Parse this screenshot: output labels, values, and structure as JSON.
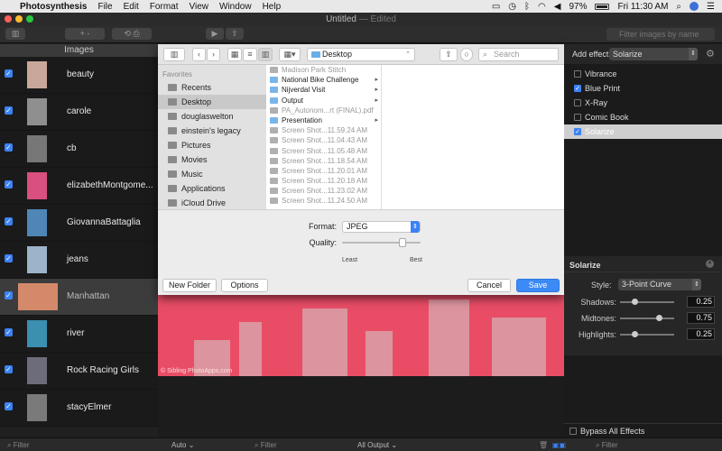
{
  "menubar": {
    "app_name": "Photosynthesis",
    "items": [
      "File",
      "Edit",
      "Format",
      "View",
      "Window",
      "Help"
    ],
    "battery": "97%",
    "clock": "Fri 11:30 AM"
  },
  "window": {
    "title": "Untitled",
    "title_suffix": "— Edited"
  },
  "toolbar": {
    "filter_placeholder": "Filter images by name"
  },
  "sidebar": {
    "header": "Images",
    "images": [
      {
        "name": "beauty",
        "checked": true,
        "thumb_color": "#c9a89a"
      },
      {
        "name": "carole",
        "checked": true,
        "thumb_color": "#8f8f8f"
      },
      {
        "name": "cb",
        "checked": true,
        "thumb_color": "#777777"
      },
      {
        "name": "elizabethMontgome...",
        "checked": true,
        "thumb_color": "#d94f7f"
      },
      {
        "name": "GiovannaBattaglia",
        "checked": true,
        "thumb_color": "#4f86b8"
      },
      {
        "name": "jeans",
        "checked": true,
        "thumb_color": "#9cb3c9"
      },
      {
        "name": "Manhattan",
        "checked": true,
        "thumb_color": "#d48a6a"
      },
      {
        "name": "river",
        "checked": true,
        "thumb_color": "#3b8fb0"
      },
      {
        "name": "Rock Racing Girls",
        "checked": true,
        "thumb_color": "#6c6c7a"
      },
      {
        "name": "stacyElmer",
        "checked": true,
        "thumb_color": "#7a7a7a"
      }
    ]
  },
  "save_sheet": {
    "location": "Desktop",
    "search_placeholder": "Search",
    "favorites_title": "Favorites",
    "favorites": [
      "Recents",
      "Desktop",
      "douglaswelton",
      "einstein's legacy",
      "Pictures",
      "Movies",
      "Music",
      "Applications",
      "iCloud Drive"
    ],
    "selected_favorite": "Desktop",
    "files": [
      {
        "name": "Madison Park Stitch",
        "folder": false
      },
      {
        "name": "National Bike Challenge",
        "folder": true
      },
      {
        "name": "Nijverdal Visit",
        "folder": true
      },
      {
        "name": "Output",
        "folder": true
      },
      {
        "name": "PA_Autonom...rt (FINAL).pdf",
        "folder": false
      },
      {
        "name": "Presentation",
        "folder": true
      },
      {
        "name": "Screen Shot...11.59.24 AM",
        "folder": false
      },
      {
        "name": "Screen Shot...11.04.43 AM",
        "folder": false
      },
      {
        "name": "Screen Shot...11.05.48 AM",
        "folder": false
      },
      {
        "name": "Screen Shot...11.18.54 AM",
        "folder": false
      },
      {
        "name": "Screen Shot...11.20.01 AM",
        "folder": false
      },
      {
        "name": "Screen Shot...11.20.18 AM",
        "folder": false
      },
      {
        "name": "Screen Shot...11.23.02 AM",
        "folder": false
      },
      {
        "name": "Screen Shot...11.24.50 AM",
        "folder": false
      }
    ],
    "format_label": "Format:",
    "format_value": "JPEG",
    "quality_label": "Quality:",
    "quality_fraction": 0.8,
    "quality_min_label": "Least",
    "quality_max_label": "Best",
    "new_folder": "New Folder",
    "options": "Options",
    "cancel": "Cancel",
    "save": "Save"
  },
  "preview": {
    "copyright": "© Sibling PhotoApps.com"
  },
  "effects": {
    "add_label": "Add effect:",
    "selected_effect": "Solarize",
    "list": [
      {
        "name": "Vibrance",
        "checked": false
      },
      {
        "name": "Blue Print",
        "checked": true
      },
      {
        "name": "X-Ray",
        "checked": false
      },
      {
        "name": "Comic Book",
        "checked": false
      },
      {
        "name": "Solarize",
        "checked": true
      }
    ]
  },
  "solarize": {
    "title": "Solarize",
    "style_label": "Style:",
    "style_value": "3-Point Curve",
    "params": [
      {
        "label": "Shadows:",
        "value": "0.25",
        "fraction": 0.25
      },
      {
        "label": "Midtones:",
        "value": "0.75",
        "fraction": 0.75
      },
      {
        "label": "Highlights:",
        "value": "0.25",
        "fraction": 0.25
      }
    ]
  },
  "bypass_label": "Bypass All Effects",
  "statusbar": {
    "filter_left": "Filter",
    "auto": "Auto",
    "filter_mid": "Filter",
    "all_output": "All Output",
    "filter_right": "Filter"
  },
  "colors": {
    "accent": "#3b82f6",
    "preview": "#e94d66"
  }
}
